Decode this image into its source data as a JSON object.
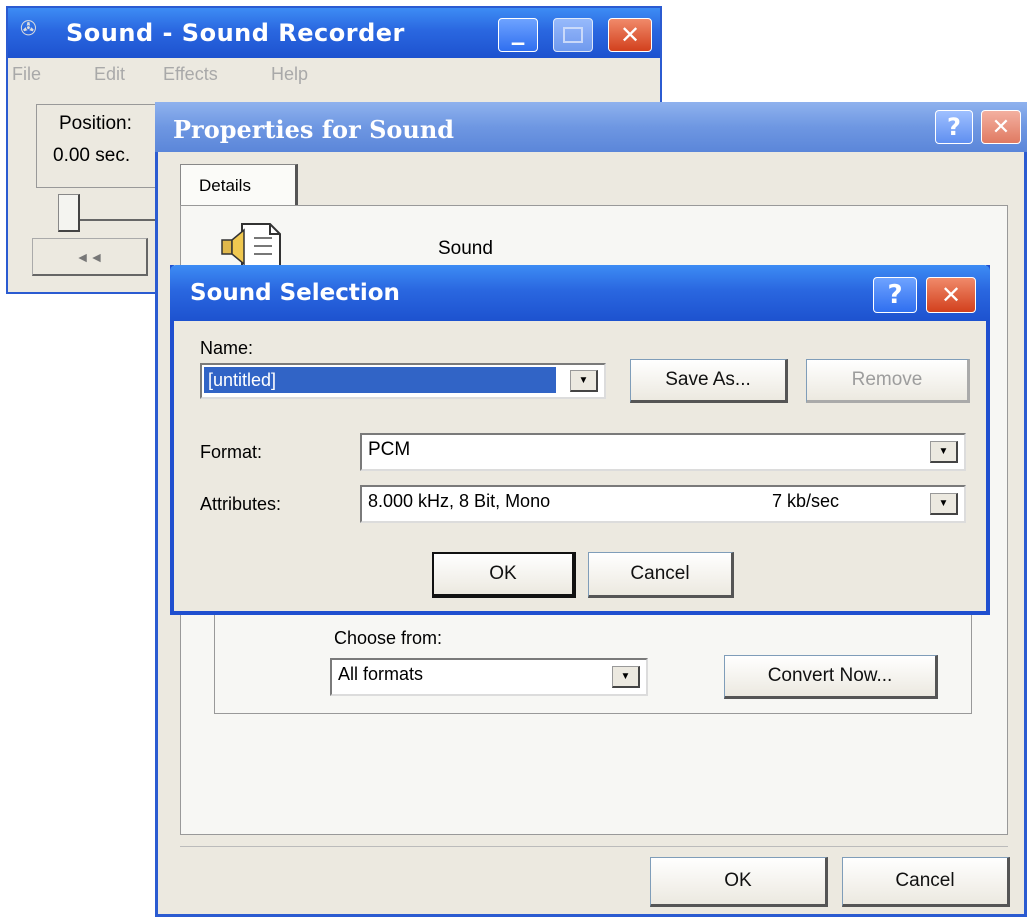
{
  "recorder": {
    "title": "Sound - Sound Recorder",
    "menu": [
      "File",
      "Edit",
      "Effects",
      "Help"
    ],
    "position_label": "Position:",
    "position_value": "0.00 sec.",
    "rewind_glyph": "◄◄"
  },
  "properties": {
    "title": "Properties for Sound",
    "help_glyph": "?",
    "close_glyph": "✕",
    "tab_details": "Details",
    "sound_name": "Sound",
    "choose_from_label": "Choose from:",
    "choose_from_value": "All formats",
    "convert_now": "Convert Now...",
    "ok": "OK",
    "cancel": "Cancel"
  },
  "selection": {
    "title": "Sound Selection",
    "help_glyph": "?",
    "close_glyph": "✕",
    "name_label": "Name:",
    "name_value": "[untitled]",
    "save_as": "Save As...",
    "remove": "Remove",
    "format_label": "Format:",
    "format_value": "PCM",
    "attributes_label": "Attributes:",
    "attributes_value": "8.000 kHz, 8 Bit, Mono",
    "attributes_rate": "7 kb/sec",
    "ok": "OK",
    "cancel": "Cancel"
  },
  "icons": {
    "dropdown": "▼",
    "minimize": "▁"
  }
}
